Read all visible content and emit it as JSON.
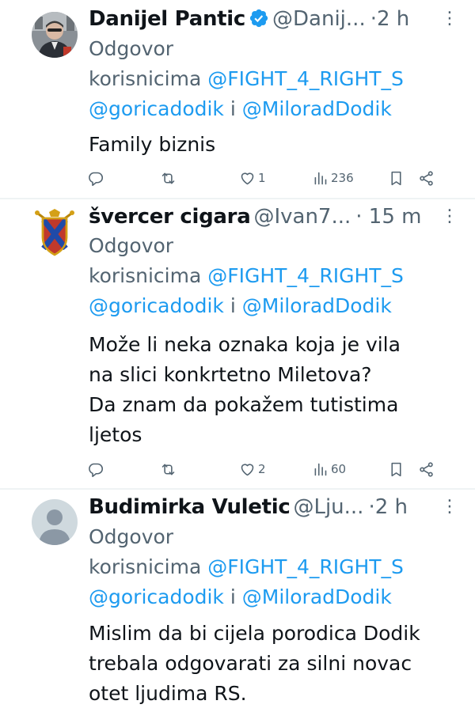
{
  "tweets": [
    {
      "name": "Danijel Pantic",
      "handle": "@Danij...",
      "sep": "·",
      "time": "2 h",
      "verified": true,
      "reply_label": "Odgovor",
      "reply_prefix": "korisnicima",
      "mention1": "@FIGHT_4_RIGHT_S",
      "mention2": "@goricadodik",
      "conj": "i",
      "mention3": "@MiloradDodik",
      "text_lines": [
        "Family biznis"
      ],
      "likes": "1",
      "views": "236"
    },
    {
      "name": "švercer cigara",
      "handle": "@Ivan7...",
      "sep": "·",
      "time": "15 m",
      "verified": false,
      "reply_label": "Odgovor",
      "reply_prefix": "korisnicima",
      "mention1": "@FIGHT_4_RIGHT_S",
      "mention2": "@goricadodik",
      "conj": "i",
      "mention3": "@MiloradDodik",
      "text_lines": [
        "Može li neka oznaka koja je vila",
        "na slici konkrtetno Miletova?",
        "Da znam da pokažem tutistima",
        "ljetos"
      ],
      "likes": "2",
      "views": "60"
    },
    {
      "name": "Budimirka Vuletic",
      "handle": "@Lju...",
      "sep": "·",
      "time": "2 h",
      "verified": false,
      "reply_label": "Odgovor",
      "reply_prefix": "korisnicima",
      "mention1": "@FIGHT_4_RIGHT_S",
      "mention2": "@goricadodik",
      "conj": "i",
      "mention3": "@MiloradDodik",
      "text_lines": [
        "Mislim da bi cijela porodica Dodik",
        "trebala odgovarati za silni novac",
        "otet ljudima RS."
      ]
    }
  ],
  "colors": {
    "link": "#1d9bf0",
    "secondary_text": "#536471",
    "primary_text": "#0f1419",
    "divider": "#eff3f4",
    "verified_badge": "#1d9bf0"
  },
  "icons": [
    "reply-icon",
    "retweet-icon",
    "like-icon",
    "views-icon",
    "bookmark-icon",
    "share-icon",
    "more-icon",
    "verified-badge-icon"
  ]
}
